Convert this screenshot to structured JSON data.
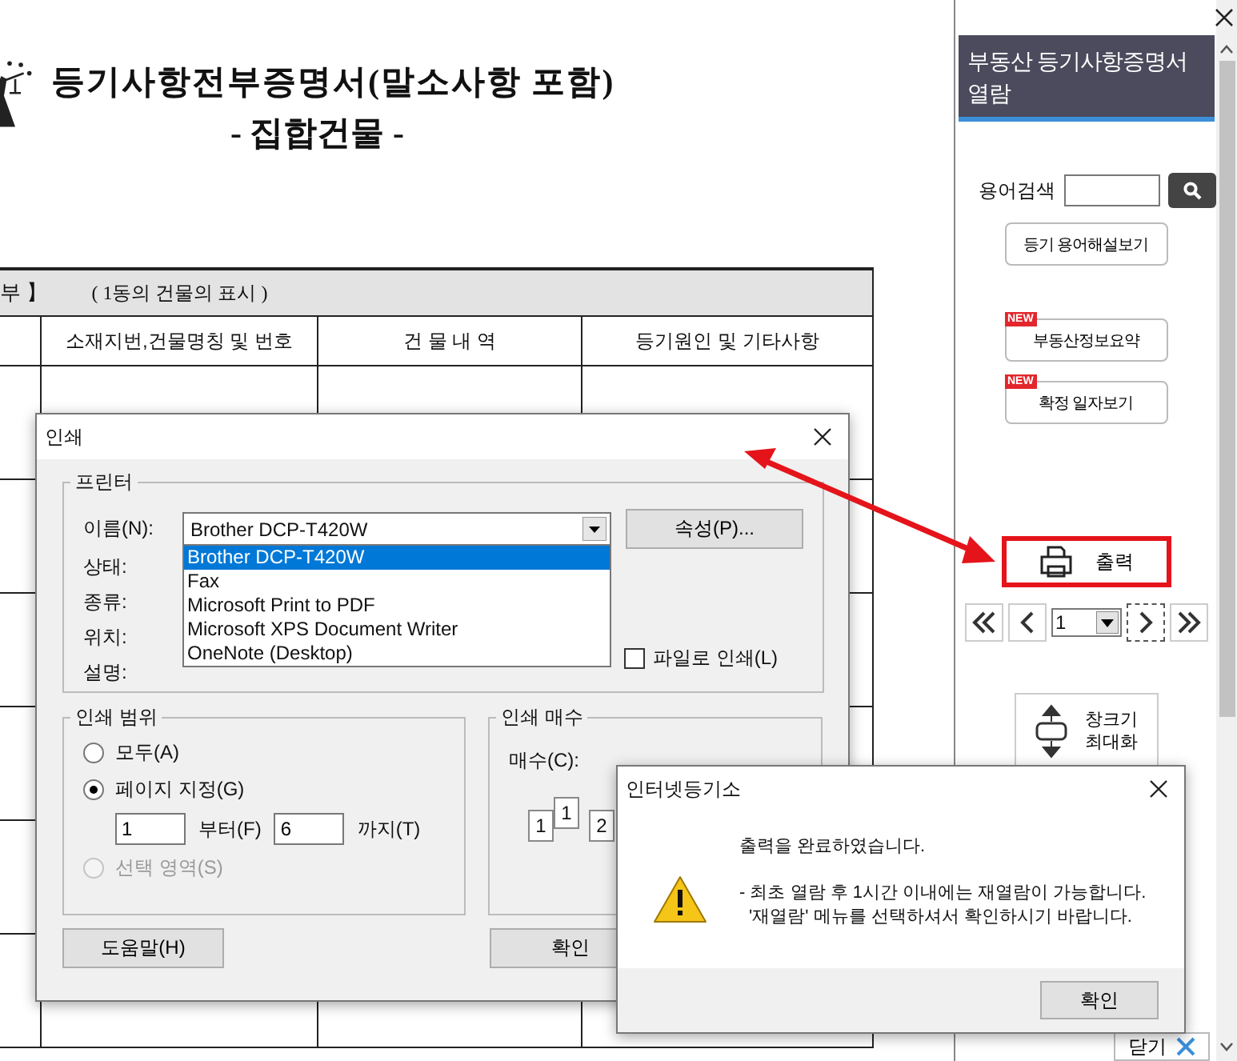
{
  "document": {
    "title": "등기사항전부증명서(말소사항 포함)",
    "subtitle": "- 집합건물 -",
    "section_header": "부 】",
    "section_note": "( 1동의 건물의 표시 )",
    "columns": [
      "소재지번,건물명칭 및 번호",
      "건 물 내 역",
      "등기원인 및 기타사항"
    ]
  },
  "sidebar": {
    "title": "부동산 등기사항증명서 열람",
    "search_label": "용어검색",
    "buttons": [
      {
        "label": "등기 용어해설보기"
      },
      {
        "label": "부동산정보요약",
        "badge": "NEW"
      },
      {
        "label": "확정 일자보기",
        "badge": "NEW"
      }
    ],
    "print_button": {
      "label": "출력",
      "highlighted": true
    },
    "page": "1",
    "resize_button": "창크기 최대화",
    "close_button": "닫기"
  },
  "print_dialog": {
    "title": "인쇄",
    "printer_group": "프린터",
    "name_label": "이름(N):",
    "printer": "Brother DCP-T420W",
    "properties_button": "속성(P)...",
    "info_labels": [
      "상태:",
      "종류:",
      "위치:",
      "설명:"
    ],
    "printer_options": [
      {
        "label": "Brother DCP-T420W",
        "selected": true
      },
      {
        "label": "Fax",
        "selected": false
      },
      {
        "label": "Microsoft Print to PDF",
        "selected": false
      },
      {
        "label": "Microsoft XPS Document Writer",
        "selected": false
      },
      {
        "label": "OneNote (Desktop)",
        "selected": false
      }
    ],
    "print_to_file": {
      "label": "파일로 인쇄(L)",
      "checked": false
    },
    "range_group": "인쇄 범위",
    "range_options": [
      {
        "label": "모두(A)",
        "selected": false,
        "disabled": false
      },
      {
        "label": "페이지 지정(G)",
        "selected": true,
        "disabled": false
      },
      {
        "label": "선택 영역(S)",
        "selected": false,
        "disabled": true
      }
    ],
    "from": "1",
    "from_label": "부터(F)",
    "to": "6",
    "to_label": "까지(T)",
    "copies_group": "인쇄 매수",
    "copies_label": "매수(C):",
    "collate_pages": [
      "1",
      "1",
      "2"
    ],
    "help_button": "도움말(H)",
    "ok_button": "확인"
  },
  "message_box": {
    "title": "인터넷등기소",
    "message": "출력을 완료하였습니다.",
    "notes": [
      "- 최초 열람 후 1시간 이내에는 재열람이 가능합니다.",
      "'재열람' 메뉴를 선택하셔서 확인하시기 바랍니다."
    ],
    "ok_button": "확인"
  }
}
